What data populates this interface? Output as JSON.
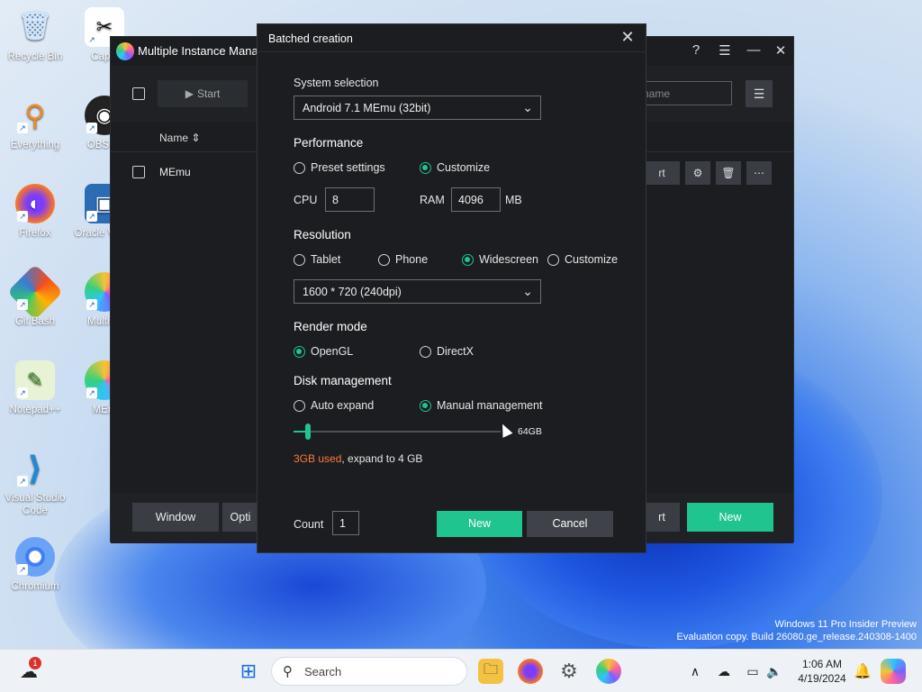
{
  "desktop": {
    "icons": [
      {
        "label": "Recycle Bin",
        "icon": "recycle-bin-icon"
      },
      {
        "label": "CapC",
        "icon": "capcut-icon"
      },
      {
        "label": "Everything",
        "icon": "everything-search-icon"
      },
      {
        "label": "OBS St",
        "icon": "obs-studio-icon"
      },
      {
        "label": "Firefox",
        "icon": "firefox-icon"
      },
      {
        "label": "Oracle Virtua",
        "icon": "virtualbox-icon"
      },
      {
        "label": "Git Bash",
        "icon": "git-bash-icon"
      },
      {
        "label": "Multi-M",
        "icon": "multi-memu-icon"
      },
      {
        "label": "Notepad++",
        "icon": "notepadpp-icon"
      },
      {
        "label": "MEm",
        "icon": "memu-icon"
      },
      {
        "label": "Visual Studio Code",
        "icon": "vscode-icon"
      },
      {
        "label": "Chromium",
        "icon": "chromium-icon"
      }
    ],
    "watermark": {
      "line1": "Windows 11 Pro Insider Preview",
      "line2": "Evaluation copy. Build 26080.ge_release.240308-1400"
    }
  },
  "mim": {
    "title": "Multiple Instance Manag",
    "toolbar": {
      "start_label": "Start",
      "search_placeholder": "h name"
    },
    "column_name": "Name",
    "row": {
      "name": "MEmu",
      "start_label": "rt"
    },
    "bottom": {
      "window_label": "Window",
      "options_label": "Opti",
      "start_label": "rt",
      "new_label": "New"
    }
  },
  "dialog": {
    "title": "Batched creation",
    "system_selection": {
      "label": "System selection",
      "value": "Android 7.1 MEmu (32bit)"
    },
    "performance": {
      "label": "Performance",
      "options": [
        "Preset settings",
        "Customize"
      ],
      "selected": "Customize",
      "cpu_label": "CPU",
      "cpu_value": "8",
      "ram_label": "RAM",
      "ram_value": "4096",
      "ram_unit": "MB"
    },
    "resolution": {
      "label": "Resolution",
      "options": [
        "Tablet",
        "Phone",
        "Widescreen",
        "Customize"
      ],
      "selected": "Widescreen",
      "value": "1600 * 720 (240dpi)"
    },
    "render_mode": {
      "label": "Render mode",
      "options": [
        "OpenGL",
        "DirectX"
      ],
      "selected": "OpenGL"
    },
    "disk": {
      "label": "Disk management",
      "options": [
        "Auto expand",
        "Manual management"
      ],
      "selected": "Manual management",
      "slider_max": "64GB",
      "slider_fraction": 0.07,
      "used_text": "3GB used",
      "expand_text": ", expand to 4 GB"
    },
    "count_label": "Count",
    "count_value": "1",
    "new_label": "New",
    "cancel_label": "Cancel"
  },
  "taskbar": {
    "search_label": "Search",
    "time": "1:06 AM",
    "date": "4/19/2024",
    "weather_badge": "1"
  },
  "colors": {
    "accent": "#1fc48f",
    "warning": "#ff7a3a"
  }
}
